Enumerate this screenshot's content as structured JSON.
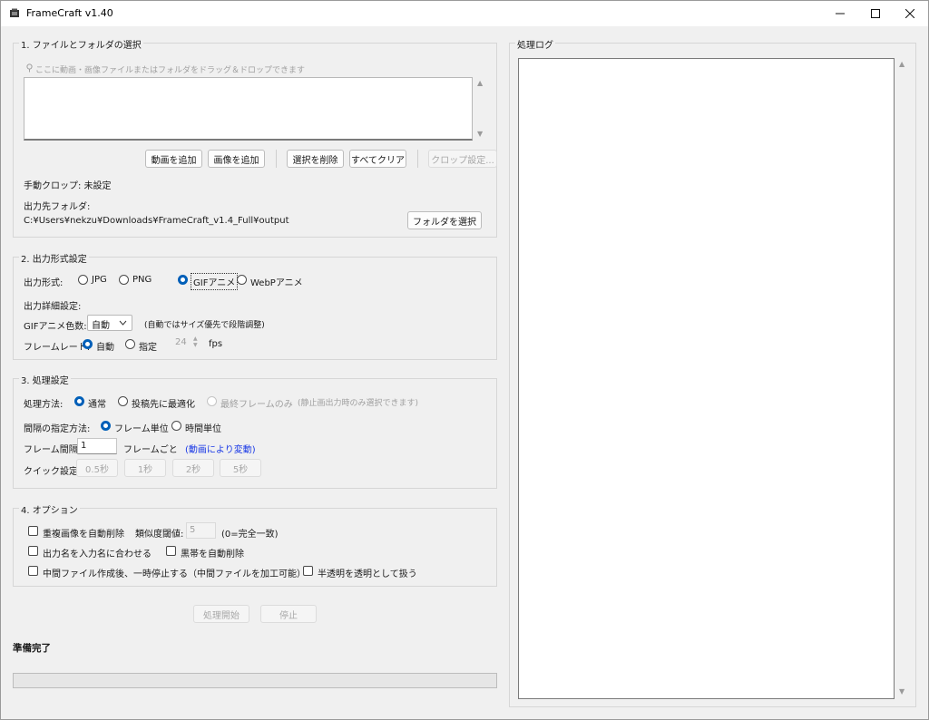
{
  "window": {
    "title": "FrameCraft v1.40"
  },
  "files": {
    "section_label": "1. ファイルとフォルダの選択",
    "drop_hint": "ここに動画・画像ファイルまたはフォルダをドラッグ＆ドロップできます",
    "buttons": {
      "add_video": "動画を追加",
      "add_image": "画像を追加",
      "remove_selected": "選択を削除",
      "clear_all": "すべてクリア",
      "crop_settings": "クロップ設定..."
    },
    "manual_crop": "手動クロップ: 未設定",
    "output_folder_label": "出力先フォルダ:",
    "output_folder_path": "C:¥Users¥nekzu¥Downloads¥FrameCraft_v1.4_Full¥output",
    "select_folder_button": "フォルダを選択"
  },
  "format": {
    "section_label": "2. 出力形式設定",
    "output_format_label": "出力形式:",
    "options": [
      "JPG",
      "PNG",
      "GIFアニメ",
      "WebPアニメ"
    ],
    "selected": "GIFアニメ",
    "detail_label": "出力詳細設定:",
    "gif_colors_label": "GIFアニメ色数:",
    "gif_colors_value": "自動",
    "gif_colors_note": "(自動ではサイズ優先で段階調整)",
    "frame_rate_label": "フレームレート:",
    "frame_rate_auto": "自動",
    "frame_rate_manual": "指定",
    "fps_value": "24",
    "fps_unit": "fps"
  },
  "processing": {
    "section_label": "3. 処理設定",
    "method_label": "処理方法:",
    "method_normal": "通常",
    "method_optimize": "投稿先に最適化",
    "method_last_frame": "最終フレームのみ",
    "method_last_frame_note": "(静止画出力時のみ選択できます)",
    "interval_mode_label": "間隔の指定方法:",
    "interval_frame": "フレーム単位",
    "interval_time": "時間単位",
    "frame_interval_label": "フレーム間隔:",
    "frame_interval_value": "1",
    "frame_interval_unit": "フレームごと",
    "frame_interval_note": "(動画により変動)",
    "quick_label": "クイック設定:",
    "quick_buttons": [
      "0.5秒",
      "1秒",
      "2秒",
      "5秒"
    ]
  },
  "options": {
    "section_label": "4. オプション",
    "dedupe": "重複画像を自動削除",
    "similarity_label": "類似度閾値:",
    "similarity_value": "5",
    "similarity_note": "(0=完全一致)",
    "match_name": "出力名を入力名に合わせる",
    "remove_black_bars": "黒帯を自動削除",
    "pause_after_intermediate": "中間ファイル作成後、一時停止する（中間ファイルを加工可能）",
    "semi_transparent": "半透明を透明として扱う"
  },
  "actions": {
    "start": "処理開始",
    "stop": "停止"
  },
  "status": {
    "text": "準備完了",
    "progress": 0
  },
  "log": {
    "section_label": "処理ログ"
  },
  "colors": {
    "accent": "#005fb8",
    "note_blue": "#1a39e6"
  },
  "icons": [
    "app-icon",
    "minimize-icon",
    "maximize-icon",
    "close-icon",
    "pin-icon",
    "scroll-up-icon",
    "scroll-down-icon",
    "chevron-down-icon"
  ]
}
